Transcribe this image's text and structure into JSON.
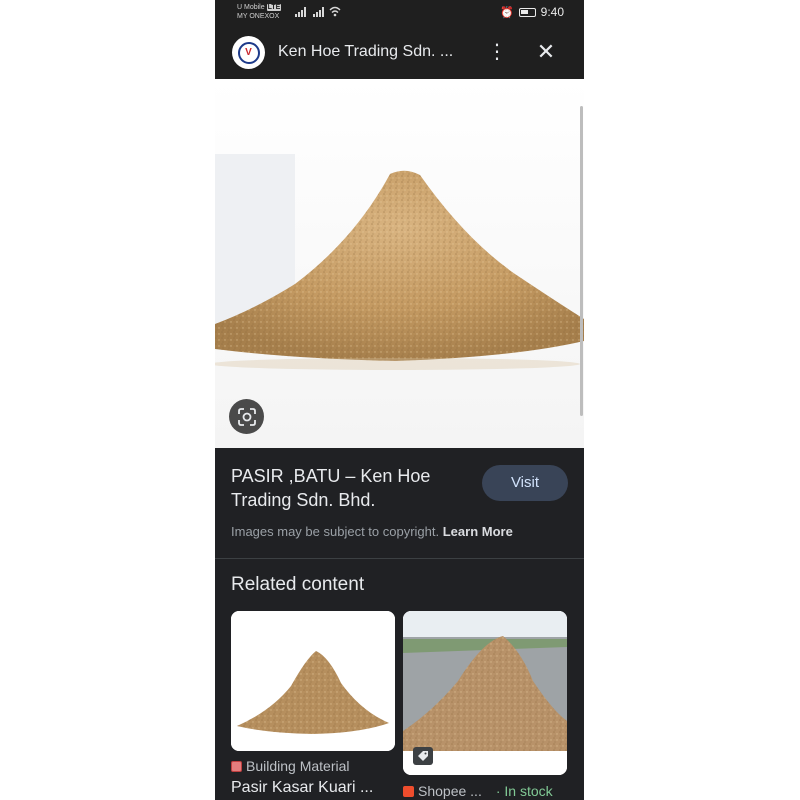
{
  "status_bar": {
    "carrier_line1": "U Mobile",
    "carrier_badge": "LTE",
    "carrier_line2": "MY ONEXOX",
    "time": "9:40"
  },
  "header": {
    "site_title": "Ken Hoe Trading Sdn. ..."
  },
  "result": {
    "title": "PASIR ,BATU – Ken Hoe Trading Sdn. Bhd.",
    "visit_label": "Visit",
    "copyright_text": "Images may be subject to copyright.",
    "learn_more_label": "Learn More"
  },
  "related": {
    "heading": "Related content",
    "cards": [
      {
        "source": "Building Material",
        "title": "Pasir Kasar Kuari ..."
      },
      {
        "source": "Shopee ...",
        "availability": "· In stock"
      }
    ]
  },
  "colors": {
    "background": "#202124",
    "visit_button": "#394457",
    "in_stock": "#81c995",
    "sand": "#c9a06a"
  }
}
